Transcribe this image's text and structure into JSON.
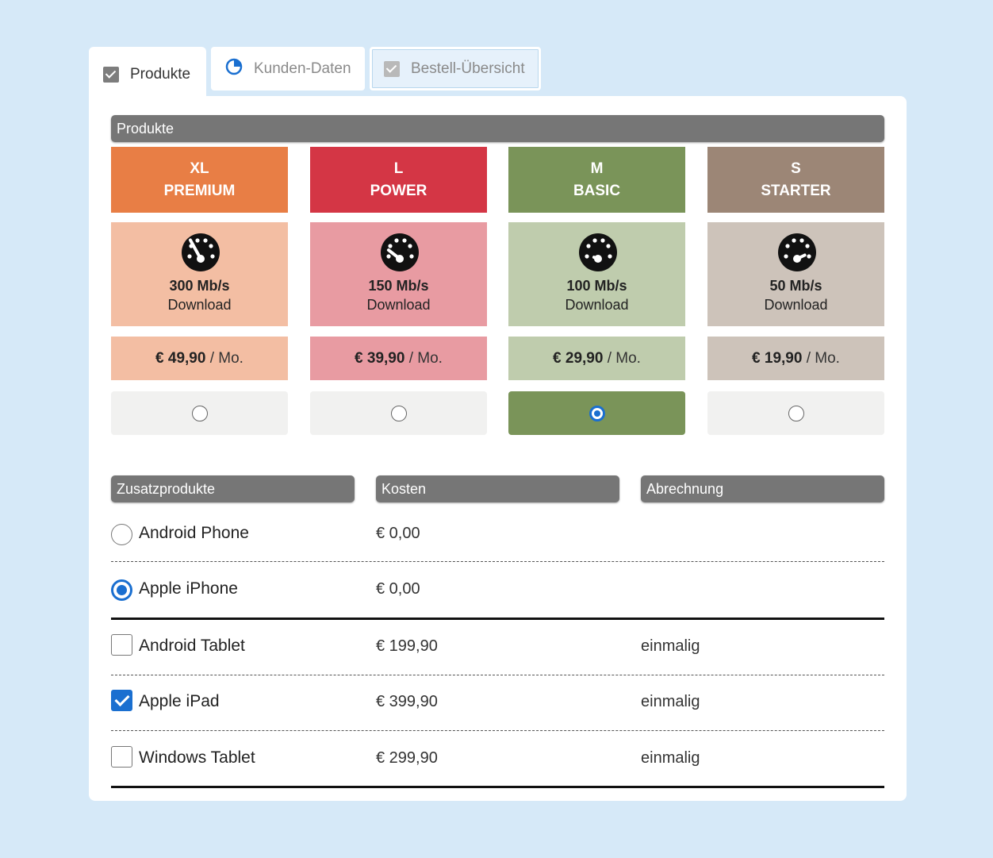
{
  "tabs": [
    {
      "label": "Produkte",
      "icon": "checkbox-checked-icon",
      "state": "active"
    },
    {
      "label": "Kunden-Daten",
      "icon": "pie-progress-icon",
      "state": "inactive"
    },
    {
      "label": "Bestell-Übersicht",
      "icon": "checkbox-checked-icon",
      "state": "disabled"
    }
  ],
  "section_title": "Produkte",
  "plans": [
    {
      "size": "XL",
      "name": "PREMIUM",
      "speed": "300 Mb/s",
      "speed_label": "Download",
      "price": "€ 49,90",
      "period": "/ Mo.",
      "color": "#e87e45",
      "light_color": "#f3bea3",
      "selected": false
    },
    {
      "size": "L",
      "name": "POWER",
      "speed": "150 Mb/s",
      "speed_label": "Download",
      "price": "€ 39,90",
      "period": "/ Mo.",
      "color": "#d43645",
      "light_color": "#e89ba2",
      "selected": false
    },
    {
      "size": "M",
      "name": "BASIC",
      "speed": "100 Mb/s",
      "speed_label": "Download",
      "price": "€ 29,90",
      "period": "/ Mo.",
      "color": "#7a9459",
      "light_color": "#bfccad",
      "selected": true
    },
    {
      "size": "S",
      "name": "STARTER",
      "speed": "50 Mb/s",
      "speed_label": "Download",
      "price": "€ 19,90",
      "period": "/ Mo.",
      "color": "#9c8676",
      "light_color": "#cdc3ba",
      "selected": false
    }
  ],
  "addons_headers": {
    "product": "Zusatzprodukte",
    "cost": "Kosten",
    "billing": "Abrechnung"
  },
  "addons": [
    {
      "name": "Android Phone",
      "cost": "€ 0,00",
      "billing": "",
      "control": "radio",
      "checked": false
    },
    {
      "name": "Apple iPhone",
      "cost": "€ 0,00",
      "billing": "",
      "control": "radio",
      "checked": true
    },
    {
      "name": "Android Tablet",
      "cost": "€ 199,90",
      "billing": "einmalig",
      "control": "checkbox",
      "checked": false
    },
    {
      "name": "Apple iPad",
      "cost": "€ 399,90",
      "billing": "einmalig",
      "control": "checkbox",
      "checked": true
    },
    {
      "name": "Windows Tablet",
      "cost": "€ 299,90",
      "billing": "einmalig",
      "control": "checkbox",
      "checked": false
    }
  ],
  "colors": {
    "accent": "#1a6fd0",
    "header_bar": "#767676",
    "background": "#d6e9f8"
  }
}
